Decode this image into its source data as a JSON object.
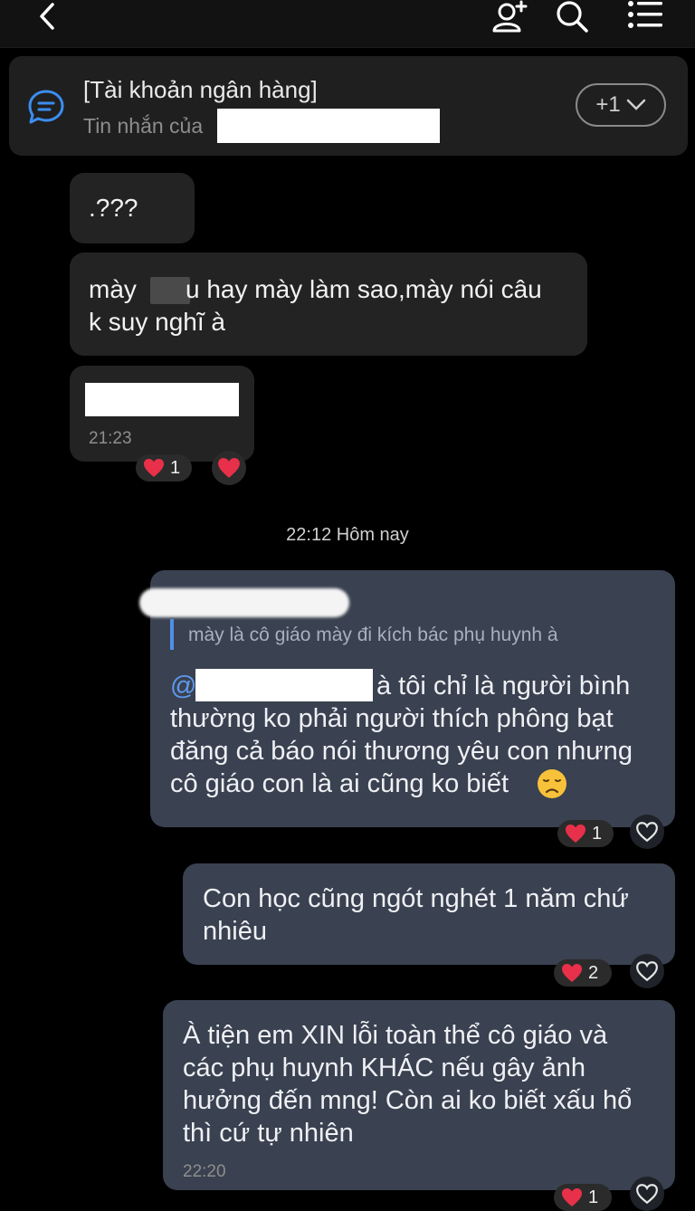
{
  "header": {
    "back_icon": "chevron-left-icon",
    "add_member_icon": "user-plus-icon",
    "search_icon": "search-icon",
    "menu_icon": "list-menu-icon"
  },
  "pinned": {
    "title": "[Tài khoản ngân hàng]",
    "subtitle": "Tin nhắn của",
    "more_label": "+1",
    "icon": "chat-bubble-icon"
  },
  "messages_in": [
    {
      "text": ".???"
    },
    {
      "line1_a": "mày",
      "line1_b": "u hay mày làm sao,mày nói câu",
      "line2": "k suy nghĩ à"
    },
    {
      "time": "21:23",
      "reaction_count": "1"
    }
  ],
  "date_separator": "22:12 Hôm nay",
  "messages_out": [
    {
      "quote": "mày là cô giáo mày đi kích bác phụ huynh à",
      "mention_at": "@",
      "line1": "à tôi chỉ là người bình",
      "line2": "thường ko phải người thích phông bạt",
      "line3": "đăng cả báo nói thương yêu con nhưng",
      "line4": "cô giáo con là ai cũng ko biết",
      "reaction_count": "1"
    },
    {
      "line1": "Con học cũng ngót nghét 1 năm chứ",
      "line2": "nhiêu",
      "reaction_count": "2"
    },
    {
      "line1": "À tiện em XIN lỗi toàn thể cô giáo và",
      "line2": "các phụ huynh KHÁC nếu gây ảnh",
      "line3": "hưởng đến mng! Còn ai ko biết xấu hổ",
      "line4": "thì cứ tự nhiên",
      "time": "22:20",
      "reaction_count": "1"
    }
  ],
  "colors": {
    "background": "#000000",
    "incoming_bubble": "#232323",
    "outgoing_bubble": "#3a4150",
    "mention": "#5d9af0",
    "heart": "#e8304a"
  }
}
